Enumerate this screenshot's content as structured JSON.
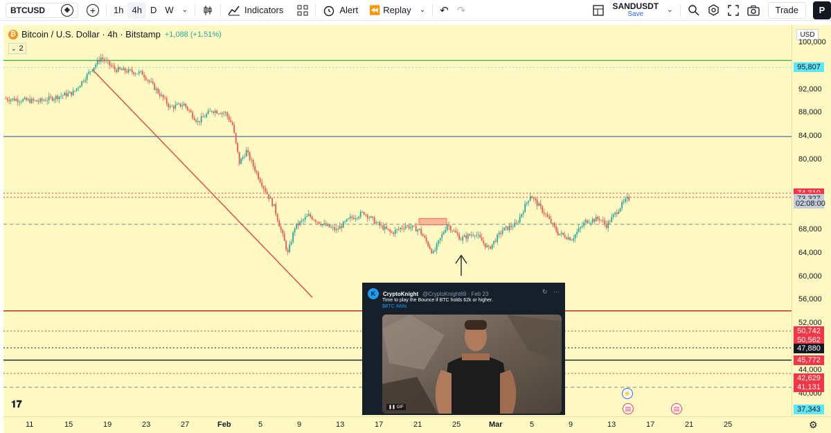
{
  "toolbar": {
    "symbol": "BTCUSD",
    "timeframes": [
      "1h",
      "4h",
      "D",
      "W"
    ],
    "active_timeframe": "4h",
    "indicators_label": "Indicators",
    "alert_label": "Alert",
    "replay_label": "Replay",
    "layout_name": "SANDUSDT",
    "layout_save": "Save",
    "trade_label": "Trade",
    "avatar_letter": "P"
  },
  "legend": {
    "title": "Bitcoin / U.S. Dollar · 4h · Bitstamp",
    "change": "+1,088 (+1.51%)",
    "indicator_count": "2"
  },
  "price_scale": {
    "currency": "USD",
    "ticks": [
      "100,000",
      "92,000",
      "88,000",
      "84,000",
      "80,000",
      "68,000",
      "64,000",
      "60,000",
      "56,000",
      "52,000",
      "44,000",
      "40,000"
    ],
    "labels": [
      {
        "text": "95,807",
        "bg": "#5ee6f7",
        "fg": "#131722",
        "price": 95807
      },
      {
        "text": "74,310",
        "bg": "#f23645",
        "fg": "#ffffff",
        "price": 74310
      },
      {
        "text": "73,619",
        "bg": "#f23645",
        "fg": "#ffffff",
        "price": 73619
      },
      {
        "text": "73,327",
        "bg": "#c7cdd8",
        "fg": "#131722",
        "price": 73327
      },
      {
        "text": "02:08:00",
        "bg": "#c7cdd8",
        "fg": "#131722",
        "price": 72520
      },
      {
        "text": "50,742",
        "bg": "#f23645",
        "fg": "#ffffff",
        "price": 50742
      },
      {
        "text": "50,562",
        "bg": "#f23645",
        "fg": "#ffffff",
        "price": 49130
      },
      {
        "text": "47,880",
        "bg": "#131722",
        "fg": "#ffffff",
        "price": 47780
      },
      {
        "text": "45,772",
        "bg": "#f23645",
        "fg": "#ffffff",
        "price": 45772
      },
      {
        "text": "42,629",
        "bg": "#f23645",
        "fg": "#ffffff",
        "price": 42629
      },
      {
        "text": "41,131",
        "bg": "#f23645",
        "fg": "#ffffff",
        "price": 41131
      },
      {
        "text": "37,343",
        "bg": "#5ee6f7",
        "fg": "#131722",
        "price": 37343
      }
    ]
  },
  "time_scale": {
    "ticks": [
      "11",
      "15",
      "19",
      "23",
      "27",
      "Feb",
      "5",
      "9",
      "13",
      "17",
      "21",
      "25",
      "Mar",
      "5",
      "9",
      "13",
      "17",
      "21",
      "25"
    ],
    "bold": [
      "Feb",
      "Mar"
    ]
  },
  "tweet": {
    "author": "CryptoKnight",
    "handle": "@CryptoKnight69 · Feb 23",
    "text": "Time to play the Bounce if BTC holds 62k or higher.",
    "tags": "$BTC #Alts",
    "media_badge": "GIF"
  },
  "colors": {
    "chart_bg": "#fef9c3",
    "candle_up": "#26a69a",
    "candle_down": "#ef5350",
    "trendline": "#e53935",
    "green_level": "#4caf50",
    "blue_level": "#5b7fa6"
  },
  "chart_data": {
    "type": "candlestick",
    "ylim": [
      37343,
      100000
    ],
    "series_path": [
      [
        0,
        90500
      ],
      [
        5,
        90000
      ],
      [
        10,
        91500
      ],
      [
        14,
        97500
      ],
      [
        16,
        95500
      ],
      [
        20,
        94800
      ],
      [
        22,
        92000
      ],
      [
        24,
        89000
      ],
      [
        26,
        89500
      ],
      [
        28,
        86500
      ],
      [
        30,
        88500
      ],
      [
        32,
        88000
      ],
      [
        33,
        86000
      ],
      [
        34,
        79500
      ],
      [
        35,
        81500
      ],
      [
        37,
        76500
      ],
      [
        39,
        72000
      ],
      [
        41,
        64000
      ],
      [
        42,
        68500
      ],
      [
        44,
        70500
      ],
      [
        46,
        69000
      ],
      [
        48,
        68000
      ],
      [
        50,
        70000
      ],
      [
        52,
        71000
      ],
      [
        54,
        69000
      ],
      [
        56,
        67500
      ],
      [
        58,
        68800
      ],
      [
        60,
        68000
      ],
      [
        62,
        64000
      ],
      [
        64,
        69000
      ],
      [
        66,
        66500
      ],
      [
        68,
        67500
      ],
      [
        70,
        64800
      ],
      [
        72,
        68000
      ],
      [
        74,
        69000
      ],
      [
        76,
        74000
      ],
      [
        78,
        71000
      ],
      [
        80,
        67500
      ],
      [
        82,
        66500
      ],
      [
        84,
        69500
      ],
      [
        86,
        70000
      ],
      [
        87,
        68800
      ],
      [
        89,
        72000
      ],
      [
        90,
        73327
      ]
    ],
    "levels": [
      {
        "price": 97000,
        "color": "#4caf50",
        "style": "solid"
      },
      {
        "price": 95807,
        "color": "#5ee6f7",
        "style": "dotted"
      },
      {
        "price": 84000,
        "color": "#5b7fa6",
        "style": "solid"
      },
      {
        "price": 74310,
        "color": "#f23645",
        "style": "dotted"
      },
      {
        "price": 73619,
        "color": "#f23645",
        "style": "dotted"
      },
      {
        "price": 69000,
        "color": "#888888",
        "style": "dashed"
      },
      {
        "price": 54200,
        "color": "#b71c1c",
        "style": "solid"
      },
      {
        "price": 50742,
        "color": "#f23645",
        "style": "dotted"
      },
      {
        "price": 47880,
        "color": "#131722",
        "style": "dotted"
      },
      {
        "price": 45772,
        "color": "#131722",
        "style": "solid"
      },
      {
        "price": 43500,
        "color": "#f23645",
        "style": "dotted"
      },
      {
        "price": 41131,
        "color": "#888888",
        "style": "dashed"
      }
    ]
  }
}
